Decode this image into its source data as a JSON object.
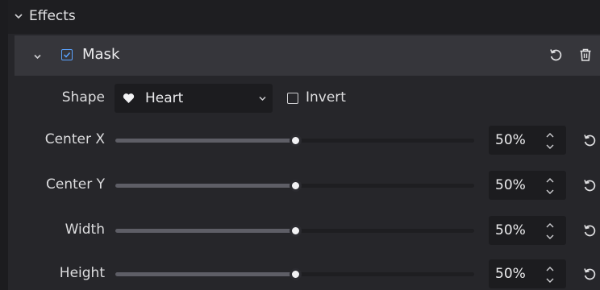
{
  "effects": {
    "title": "Effects"
  },
  "mask": {
    "title": "Mask",
    "enabled": true
  },
  "shape": {
    "label": "Shape",
    "value": "Heart",
    "icon": "heart-icon"
  },
  "invert": {
    "label": "Invert",
    "checked": false
  },
  "sliders": [
    {
      "label": "Center X",
      "value": 50,
      "display": "50%"
    },
    {
      "label": "Center Y",
      "value": 50,
      "display": "50%"
    },
    {
      "label": "Width",
      "value": 50,
      "display": "50%"
    },
    {
      "label": "Height",
      "value": 50,
      "display": "50%"
    }
  ],
  "colors": {
    "accent": "#5aa3ff",
    "panel": "#26262a",
    "header": "#36363b",
    "field": "#1c1c1f"
  }
}
